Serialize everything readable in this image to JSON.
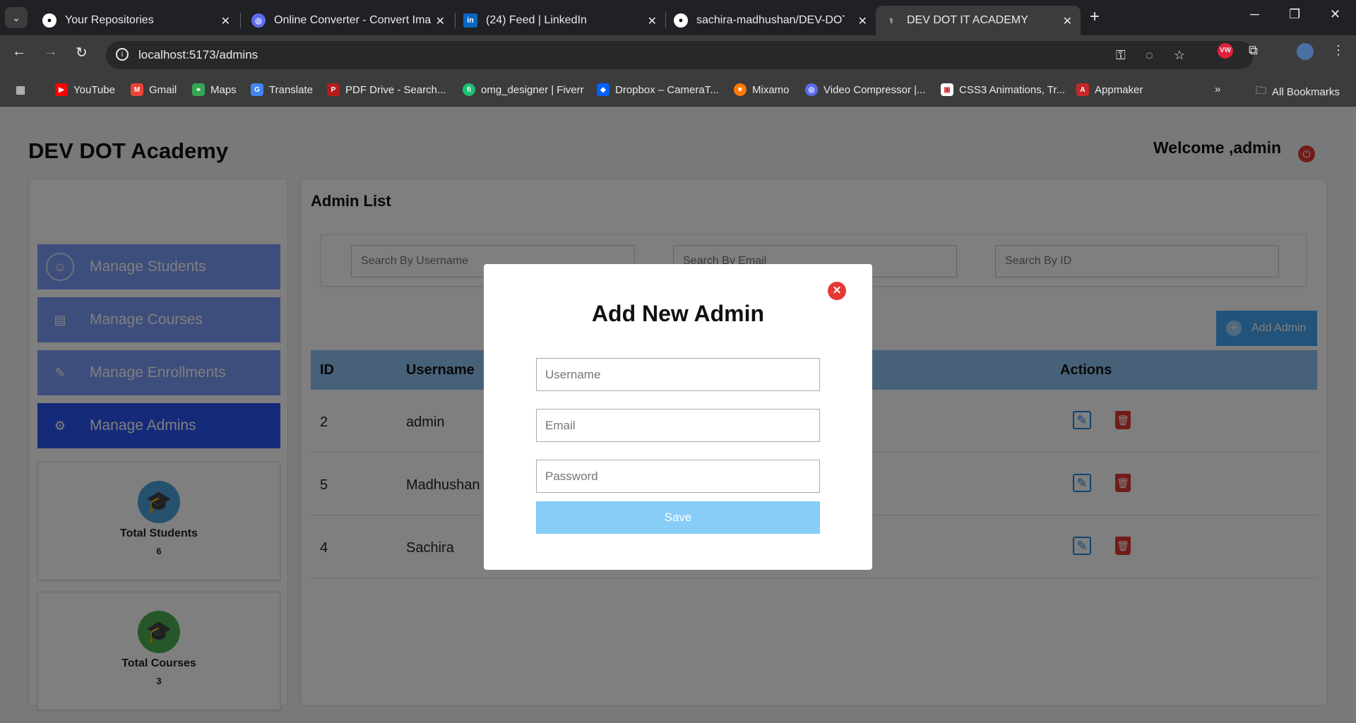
{
  "browser": {
    "tabs": [
      {
        "title": "Your Repositories",
        "icon": "github-icon"
      },
      {
        "title": "Online Converter - Convert Ima",
        "icon": "converter-icon"
      },
      {
        "title": "(24) Feed | LinkedIn",
        "icon": "linkedin-icon"
      },
      {
        "title": "sachira-madhushan/DEV-DOT-I",
        "icon": "github-icon"
      },
      {
        "title": "DEV DOT IT ACADEMY",
        "icon": "page-icon",
        "active": true
      }
    ],
    "url": "localhost:5173/admins",
    "bookmarks": [
      "YouTube",
      "Gmail",
      "Maps",
      "Translate",
      "PDF Drive - Search...",
      "omg_designer | Fiverr",
      "Dropbox – CameraT...",
      "Mixamo",
      "Video Compressor |...",
      "CSS3 Animations, Tr...",
      "Appmaker"
    ],
    "all_bookmarks": "All Bookmarks"
  },
  "app": {
    "brand": "DEV DOT Academy",
    "welcome": "Welcome ,admin"
  },
  "sidebar": {
    "items": [
      {
        "label": "Manage Students"
      },
      {
        "label": "Manage Courses"
      },
      {
        "label": "Manage Enrollments"
      },
      {
        "label": "Manage Admins",
        "active": true
      }
    ],
    "stats": [
      {
        "label": "Total Students",
        "value": "6"
      },
      {
        "label": "Total Courses",
        "value": "3"
      }
    ]
  },
  "main": {
    "title": "Admin List",
    "search": {
      "username_placeholder": "Search By Username",
      "email_placeholder": "Search By Email",
      "id_placeholder": "Search By ID"
    },
    "add_button": "Add Admin",
    "table": {
      "headers": [
        "ID",
        "Username",
        "Actions"
      ],
      "rows": [
        {
          "id": "2",
          "username": "admin"
        },
        {
          "id": "5",
          "username": "Madhushan"
        },
        {
          "id": "4",
          "username": "Sachira"
        }
      ]
    }
  },
  "modal": {
    "title": "Add New Admin",
    "username_placeholder": "Username",
    "email_placeholder": "Email",
    "password_placeholder": "Password",
    "save_label": "Save"
  },
  "colors": {
    "menu": "#7c9cf8",
    "menu_active": "#2b55f0",
    "table_header": "#8fc3f2",
    "add_button": "#45a6f5",
    "save_button": "#87cdf8",
    "danger": "#e53935"
  }
}
